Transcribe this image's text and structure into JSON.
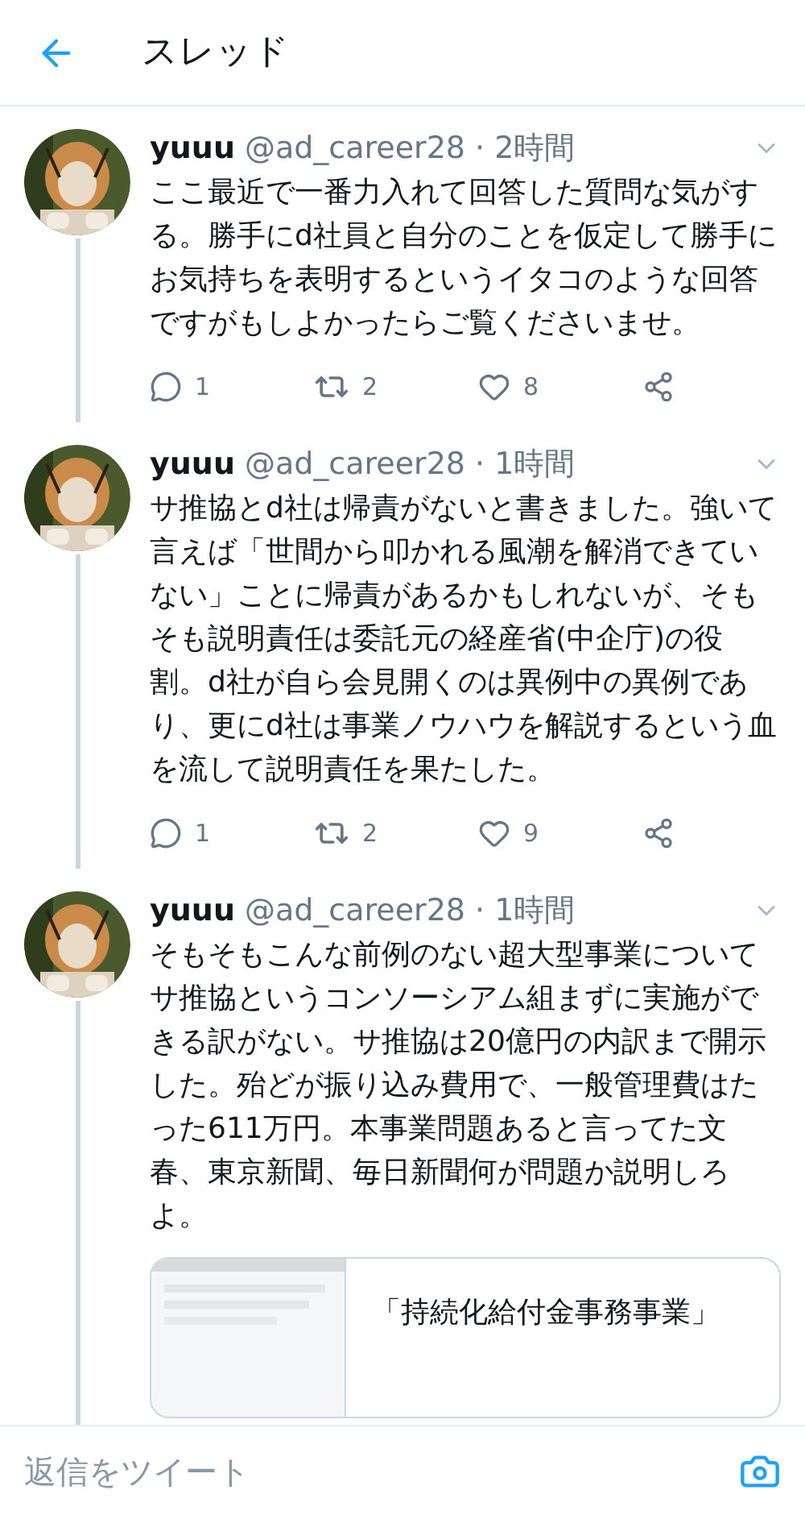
{
  "header": {
    "title": "スレッド"
  },
  "tweets": [
    {
      "name": "yuuu",
      "handle": "@ad_career28",
      "time": "· 2時間",
      "text": "ここ最近で一番力入れて回答した質問な気がする。勝手にd社員と自分のことを仮定して勝手にお気持ちを表明するというイタコのような回答ですがもしよかったらご覧くださいませ。",
      "replies": "1",
      "retweets": "2",
      "likes": "8"
    },
    {
      "name": "yuuu",
      "handle": "@ad_career28",
      "time": "· 1時間",
      "text": "サ推協とd社は帰責がないと書きました。強いて言えば「世間から叩かれる風潮を解消できていない」ことに帰責があるかもしれないが、そもそも説明責任は委託元の経産省(中企庁)の役割。d社が自ら会見開くのは異例中の異例であり、更にd社は事業ノウハウを解説するという血を流して説明責任を果たした。",
      "replies": "1",
      "retweets": "2",
      "likes": "9"
    },
    {
      "name": "yuuu",
      "handle": "@ad_career28",
      "time": "· 1時間",
      "text": "そもそもこんな前例のない超大型事業についてサ推協というコンソーシアム組まずに実施ができる訳がない。サ推協は20億円の内訳まで開示した。殆どが振り込み費用で、一般管理費はたった611万円。本事業問題あると言ってた文春、東京新聞、毎日新聞何が問題か説明しろよ。",
      "card": {
        "title": "「持続化給付金事務事業」"
      }
    }
  ],
  "reply_bar": {
    "placeholder": "返信をツイート"
  }
}
